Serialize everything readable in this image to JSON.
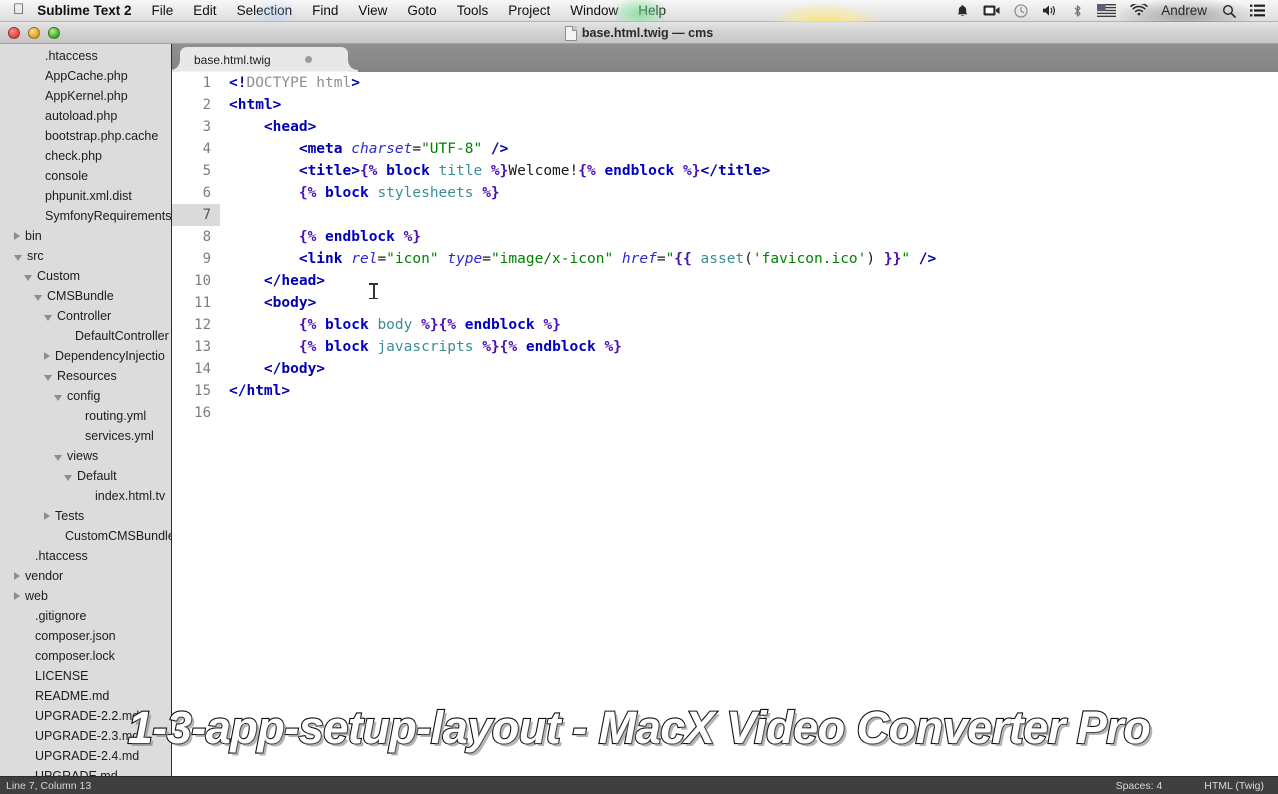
{
  "menubar": {
    "apple_icon": "apple-logo-icon",
    "app_name": "Sublime Text 2",
    "items": [
      "File",
      "Edit",
      "Selection",
      "Find",
      "View",
      "Goto",
      "Tools",
      "Project",
      "Window",
      "Help"
    ],
    "highlighted_item": "Goto",
    "status_icons": [
      "bell-icon",
      "video-camera-icon",
      "clock-icon",
      "volume-icon",
      "bluetooth-icon",
      "us-flag-icon",
      "wifi-icon"
    ],
    "user_name": "Andrew",
    "right_icons": [
      "search-icon",
      "notification-center-icon"
    ]
  },
  "titlebar": {
    "title": "base.html.twig — cms",
    "buttons": [
      "close-button",
      "minimize-button",
      "zoom-button"
    ]
  },
  "sidebar": {
    "items": [
      {
        "label": ".htaccess",
        "indent": 3,
        "arrow": "none"
      },
      {
        "label": "AppCache.php",
        "indent": 3,
        "arrow": "none"
      },
      {
        "label": "AppKernel.php",
        "indent": 3,
        "arrow": "none"
      },
      {
        "label": "autoload.php",
        "indent": 3,
        "arrow": "none"
      },
      {
        "label": "bootstrap.php.cache",
        "indent": 3,
        "arrow": "none"
      },
      {
        "label": "check.php",
        "indent": 3,
        "arrow": "none"
      },
      {
        "label": "console",
        "indent": 3,
        "arrow": "none"
      },
      {
        "label": "phpunit.xml.dist",
        "indent": 3,
        "arrow": "none"
      },
      {
        "label": "SymfonyRequirements.p",
        "indent": 3,
        "arrow": "none"
      },
      {
        "label": "bin",
        "indent": 1,
        "arrow": "closed"
      },
      {
        "label": "src",
        "indent": 1,
        "arrow": "open"
      },
      {
        "label": "Custom",
        "indent": 2,
        "arrow": "open"
      },
      {
        "label": "CMSBundle",
        "indent": 3,
        "arrow": "open"
      },
      {
        "label": "Controller",
        "indent": 4,
        "arrow": "open"
      },
      {
        "label": "DefaultController",
        "indent": 6,
        "arrow": "none"
      },
      {
        "label": "DependencyInjectio",
        "indent": 4,
        "arrow": "closed"
      },
      {
        "label": "Resources",
        "indent": 4,
        "arrow": "open"
      },
      {
        "label": "config",
        "indent": 5,
        "arrow": "open"
      },
      {
        "label": "routing.yml",
        "indent": 7,
        "arrow": "none"
      },
      {
        "label": "services.yml",
        "indent": 7,
        "arrow": "none"
      },
      {
        "label": "views",
        "indent": 5,
        "arrow": "open"
      },
      {
        "label": "Default",
        "indent": 6,
        "arrow": "open"
      },
      {
        "label": "index.html.tv",
        "indent": 8,
        "arrow": "none"
      },
      {
        "label": "Tests",
        "indent": 4,
        "arrow": "closed"
      },
      {
        "label": "CustomCMSBundle.",
        "indent": 5,
        "arrow": "none"
      },
      {
        "label": ".htaccess",
        "indent": 2,
        "arrow": "none"
      },
      {
        "label": "vendor",
        "indent": 1,
        "arrow": "closed"
      },
      {
        "label": "web",
        "indent": 1,
        "arrow": "closed"
      },
      {
        "label": ".gitignore",
        "indent": 2,
        "arrow": "none"
      },
      {
        "label": "composer.json",
        "indent": 2,
        "arrow": "none"
      },
      {
        "label": "composer.lock",
        "indent": 2,
        "arrow": "none"
      },
      {
        "label": "LICENSE",
        "indent": 2,
        "arrow": "none"
      },
      {
        "label": "README.md",
        "indent": 2,
        "arrow": "none"
      },
      {
        "label": "UPGRADE-2.2.md",
        "indent": 2,
        "arrow": "none"
      },
      {
        "label": "UPGRADE-2.3.md",
        "indent": 2,
        "arrow": "none"
      },
      {
        "label": "UPGRADE-2.4.md",
        "indent": 2,
        "arrow": "none"
      },
      {
        "label": "UPGRADE.md",
        "indent": 2,
        "arrow": "none"
      }
    ]
  },
  "tab": {
    "title": "base.html.twig",
    "modified_indicator": "close-dot-icon"
  },
  "editor": {
    "lines": [
      {
        "n": "1",
        "active": false,
        "tokens": [
          {
            "t": "<!",
            "c": "tok-tag"
          },
          {
            "t": "DOCTYPE",
            "c": "tok-doctype"
          },
          {
            "t": " html",
            "c": "tok-doctype"
          },
          {
            "t": ">",
            "c": "tok-tag"
          }
        ]
      },
      {
        "n": "2",
        "active": false,
        "tokens": [
          {
            "t": "<html>",
            "c": "tok-tag"
          }
        ]
      },
      {
        "n": "3",
        "active": false,
        "tokens": [
          {
            "t": "    ",
            "c": "tok-plain"
          },
          {
            "t": "<head>",
            "c": "tok-tag"
          }
        ]
      },
      {
        "n": "4",
        "active": false,
        "tokens": [
          {
            "t": "        ",
            "c": "tok-plain"
          },
          {
            "t": "<meta",
            "c": "tok-tag"
          },
          {
            "t": " ",
            "c": "tok-plain"
          },
          {
            "t": "charset",
            "c": "tok-attr"
          },
          {
            "t": "=",
            "c": "tok-eq"
          },
          {
            "t": "\"UTF-8\"",
            "c": "tok-str"
          },
          {
            "t": " ",
            "c": "tok-plain"
          },
          {
            "t": "/>",
            "c": "tok-slash"
          }
        ]
      },
      {
        "n": "5",
        "active": false,
        "tokens": [
          {
            "t": "        ",
            "c": "tok-plain"
          },
          {
            "t": "<title>",
            "c": "tok-tag"
          },
          {
            "t": "{% ",
            "c": "tok-twig"
          },
          {
            "t": "block",
            "c": "tok-twigkw"
          },
          {
            "t": " ",
            "c": "tok-plain"
          },
          {
            "t": "title",
            "c": "tok-twigname"
          },
          {
            "t": " %}",
            "c": "tok-twig"
          },
          {
            "t": "Welcome!",
            "c": "tok-plain"
          },
          {
            "t": "{% ",
            "c": "tok-twig"
          },
          {
            "t": "endblock",
            "c": "tok-twigkw"
          },
          {
            "t": " %}",
            "c": "tok-twig"
          },
          {
            "t": "</title>",
            "c": "tok-tag"
          }
        ]
      },
      {
        "n": "6",
        "active": false,
        "tokens": [
          {
            "t": "        ",
            "c": "tok-plain"
          },
          {
            "t": "{% ",
            "c": "tok-twig"
          },
          {
            "t": "block",
            "c": "tok-twigkw"
          },
          {
            "t": " ",
            "c": "tok-plain"
          },
          {
            "t": "stylesheets",
            "c": "tok-twigname"
          },
          {
            "t": " %}",
            "c": "tok-twig"
          }
        ]
      },
      {
        "n": "7",
        "active": true,
        "tokens": [
          {
            "t": "            ",
            "c": "tok-plain"
          }
        ]
      },
      {
        "n": "8",
        "active": false,
        "tokens": [
          {
            "t": "        ",
            "c": "tok-plain"
          },
          {
            "t": "{% ",
            "c": "tok-twig"
          },
          {
            "t": "endblock",
            "c": "tok-twigkw"
          },
          {
            "t": " %}",
            "c": "tok-twig"
          }
        ]
      },
      {
        "n": "9",
        "active": false,
        "tokens": [
          {
            "t": "        ",
            "c": "tok-plain"
          },
          {
            "t": "<link",
            "c": "tok-tag"
          },
          {
            "t": " ",
            "c": "tok-plain"
          },
          {
            "t": "rel",
            "c": "tok-attr"
          },
          {
            "t": "=",
            "c": "tok-eq"
          },
          {
            "t": "\"icon\"",
            "c": "tok-str"
          },
          {
            "t": " ",
            "c": "tok-plain"
          },
          {
            "t": "type",
            "c": "tok-attr"
          },
          {
            "t": "=",
            "c": "tok-eq"
          },
          {
            "t": "\"image/x-icon\"",
            "c": "tok-str"
          },
          {
            "t": " ",
            "c": "tok-plain"
          },
          {
            "t": "href",
            "c": "tok-attr"
          },
          {
            "t": "=",
            "c": "tok-eq"
          },
          {
            "t": "\"",
            "c": "tok-str"
          },
          {
            "t": "{{ ",
            "c": "tok-twig"
          },
          {
            "t": "asset",
            "c": "tok-func"
          },
          {
            "t": "(",
            "c": "tok-punct"
          },
          {
            "t": "'favicon.ico'",
            "c": "tok-str"
          },
          {
            "t": ")",
            "c": "tok-punct"
          },
          {
            "t": " }}",
            "c": "tok-twig"
          },
          {
            "t": "\"",
            "c": "tok-str"
          },
          {
            "t": " ",
            "c": "tok-plain"
          },
          {
            "t": "/>",
            "c": "tok-slash"
          }
        ]
      },
      {
        "n": "10",
        "active": false,
        "tokens": [
          {
            "t": "    ",
            "c": "tok-plain"
          },
          {
            "t": "</head>",
            "c": "tok-tag"
          }
        ]
      },
      {
        "n": "11",
        "active": false,
        "tokens": [
          {
            "t": "    ",
            "c": "tok-plain"
          },
          {
            "t": "<body>",
            "c": "tok-tag"
          }
        ]
      },
      {
        "n": "12",
        "active": false,
        "tokens": [
          {
            "t": "        ",
            "c": "tok-plain"
          },
          {
            "t": "{% ",
            "c": "tok-twig"
          },
          {
            "t": "block",
            "c": "tok-twigkw"
          },
          {
            "t": " ",
            "c": "tok-plain"
          },
          {
            "t": "body",
            "c": "tok-twigname"
          },
          {
            "t": " %}",
            "c": "tok-twig"
          },
          {
            "t": "{% ",
            "c": "tok-twig"
          },
          {
            "t": "endblock",
            "c": "tok-twigkw"
          },
          {
            "t": " %}",
            "c": "tok-twig"
          }
        ]
      },
      {
        "n": "13",
        "active": false,
        "tokens": [
          {
            "t": "        ",
            "c": "tok-plain"
          },
          {
            "t": "{% ",
            "c": "tok-twig"
          },
          {
            "t": "block",
            "c": "tok-twigkw"
          },
          {
            "t": " ",
            "c": "tok-plain"
          },
          {
            "t": "javascripts",
            "c": "tok-twigname"
          },
          {
            "t": " %}",
            "c": "tok-twig"
          },
          {
            "t": "{% ",
            "c": "tok-twig"
          },
          {
            "t": "endblock",
            "c": "tok-twigkw"
          },
          {
            "t": " %}",
            "c": "tok-twig"
          }
        ]
      },
      {
        "n": "14",
        "active": false,
        "tokens": [
          {
            "t": "    ",
            "c": "tok-plain"
          },
          {
            "t": "</body>",
            "c": "tok-tag"
          }
        ]
      },
      {
        "n": "15",
        "active": false,
        "tokens": [
          {
            "t": "</html>",
            "c": "tok-tag"
          }
        ]
      },
      {
        "n": "16",
        "active": false,
        "tokens": []
      }
    ]
  },
  "statusbar": {
    "position": "Line 7, Column 13",
    "indentation": "Spaces: 4",
    "syntax": "HTML (Twig)"
  },
  "watermark": {
    "text": "1-3-app-setup-layout - MacX Video Converter Pro"
  },
  "colors": {
    "sidebar_bg": "#dcdcdc",
    "tabbar_bg": "#8a8a8a",
    "editor_bg": "#ffffff",
    "statusbar_bg": "#3f3f3f",
    "tag": "#0000b0",
    "string": "#008200",
    "twig": "#4b0fb5",
    "twig_name": "#3b8d96",
    "menu_highlight": "#e06060"
  }
}
